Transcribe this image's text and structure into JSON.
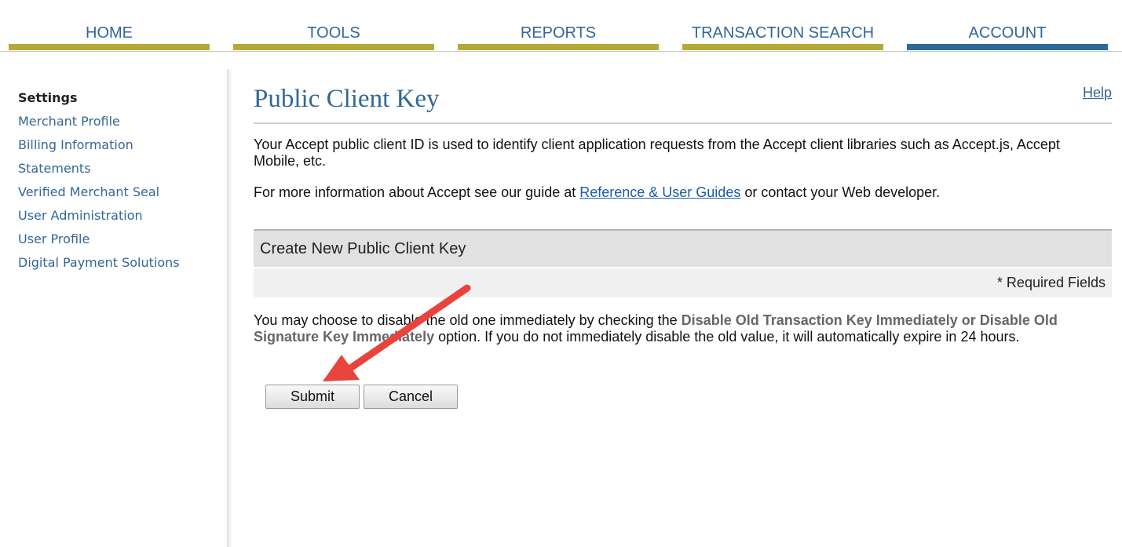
{
  "nav": {
    "tabs": [
      {
        "label": "HOME",
        "bar_color": "#b6a936"
      },
      {
        "label": "TOOLS",
        "bar_color": "#b6a936"
      },
      {
        "label": "REPORTS",
        "bar_color": "#b6a936"
      },
      {
        "label": "TRANSACTION SEARCH",
        "bar_color": "#b6a936"
      },
      {
        "label": "ACCOUNT",
        "bar_color": "#2d6a9a"
      }
    ]
  },
  "sidebar": {
    "heading": "Settings",
    "items": [
      "Merchant Profile",
      "Billing Information",
      "Statements",
      "Verified Merchant Seal",
      "User Administration",
      "User Profile",
      "Digital Payment Solutions"
    ]
  },
  "page": {
    "title": "Public Client Key",
    "help_label": "Help",
    "intro": "Your Accept public client ID is used to identify client application requests from the Accept client libraries such as Accept.js, Accept Mobile, etc.",
    "more_info_prefix": "For more information about Accept see our guide at ",
    "more_info_link": "Reference & User Guides",
    "more_info_suffix": " or contact your Web developer.",
    "section_title": "Create New Public Client Key",
    "required_fields": "* Required Fields",
    "note_prefix": "You may choose to disable the old one immediately by checking the ",
    "note_bold": "Disable Old Transaction Key Immediately or Disable Old Signature Key Immediately",
    "note_suffix": " option. If you do not immediately disable the old value, it will automatically expire in 24 hours.",
    "submit_label": "Submit",
    "cancel_label": "Cancel"
  },
  "colors": {
    "brand_blue": "#336699",
    "nav_gold": "#b6a936",
    "nav_active": "#2d6a9a",
    "annotation_red": "#e8443c"
  }
}
